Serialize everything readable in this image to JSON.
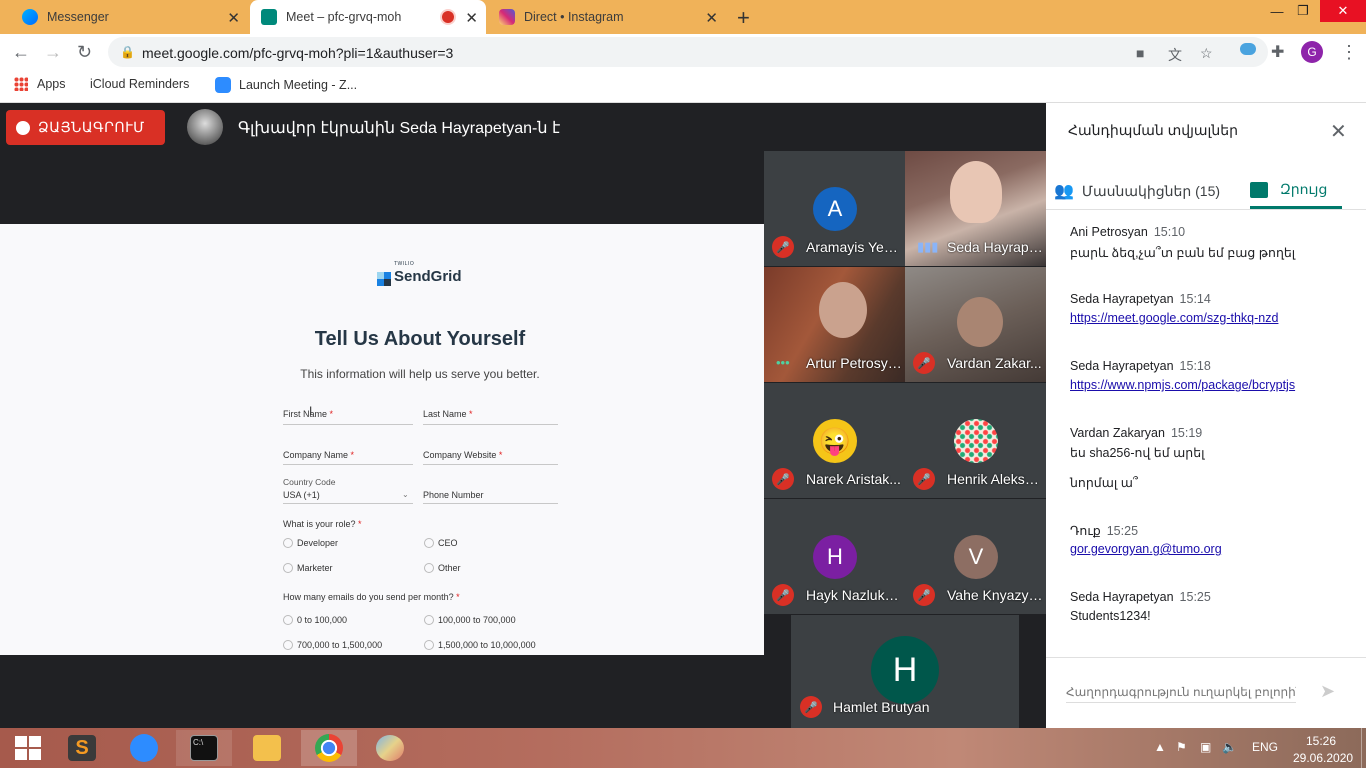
{
  "tabs": [
    {
      "label": "Messenger",
      "icon": "messenger-icon"
    },
    {
      "label": "Meet – pfc-grvq-moh",
      "icon": "meet-icon"
    },
    {
      "label": "Direct • Instagram",
      "icon": "instagram-icon"
    }
  ],
  "address": {
    "url": "meet.google.com/pfc-grvq-moh?pli=1&authuser=3"
  },
  "profile_initial": "G",
  "bookmarks": [
    {
      "label": "Apps"
    },
    {
      "label": "iCloud Reminders"
    },
    {
      "label": "Launch Meeting - Z..."
    }
  ],
  "meet": {
    "record_label": "ՁԱՅՆԱԳՐՈՒՄ",
    "presenter_text": "Գլխավոր էկրանին Seda Hayrapetyan-ն է"
  },
  "form": {
    "brand_small": "TWILIO",
    "brand": "SendGrid",
    "title": "Tell Us About Yourself",
    "subtitle": "This information will help us serve you better.",
    "first_name": "First Name",
    "last_name": "Last Name",
    "company_name": "Company Name",
    "company_website": "Company Website",
    "country_code_label": "Country Code",
    "country_code_value": "USA (+1)",
    "phone_number": "Phone Number",
    "role_question": "What is your role?",
    "roles": [
      "Developer",
      "CEO",
      "Marketer",
      "Other"
    ],
    "emails_question": "How many emails do you send per month?",
    "email_ranges": [
      "0 to 100,000",
      "100,000 to 700,000",
      "700,000 to 1,500,000",
      "1,500,000 to 10,000,000"
    ],
    "required_mark": "*"
  },
  "participants": [
    {
      "name": "Aramayis Yeg...",
      "initial": "A",
      "color": "#1565c0"
    },
    {
      "name": "Seda Hayrape...",
      "initial": "",
      "color": ""
    },
    {
      "name": "Artur Petrosyan",
      "initial": "",
      "color": ""
    },
    {
      "name": "Vardan Zakar...",
      "initial": "",
      "color": ""
    },
    {
      "name": "Narek Aristak...",
      "initial": "😜",
      "color": "#3c4043"
    },
    {
      "name": "Henrik Aleksa...",
      "initial": "",
      "color": "#e8e0d0"
    },
    {
      "name": "Hayk Nazlukh...",
      "initial": "H",
      "color": "#7b1fa2"
    },
    {
      "name": "Vahe Knyazyan",
      "initial": "V",
      "color": "#8d6e63"
    },
    {
      "name": "Hamlet Brutyan",
      "initial": "H",
      "color": "#00574b"
    }
  ],
  "panel": {
    "title": "Հանդիպման տվյալներ",
    "participants_tab": "Մասնակիցներ (15)",
    "chat_tab": "Զրույց",
    "messages": [
      {
        "sender": "Ani Petrosyan",
        "time": "15:10",
        "text": "բարև ձեզ,չա՞տ բան եմ բաց թողել"
      },
      {
        "sender": "Seda Hayrapetyan",
        "time": "15:14",
        "link": "https://meet.google.com/szg-thkq-nzd"
      },
      {
        "sender": "Seda Hayrapetyan",
        "time": "15:18",
        "link": "https://www.npmjs.com/package/bcryptjs"
      },
      {
        "sender": "Vardan Zakaryan",
        "time": "15:19",
        "text": "ես sha256-ով եմ արել",
        "text2": "նորմալ ա՞"
      },
      {
        "sender": "Դուք",
        "time": "15:25",
        "link": "gor.gevorgyan.g@tumo.org"
      },
      {
        "sender": "Seda Hayrapetyan",
        "time": "15:25",
        "text": "Students1234!"
      }
    ],
    "input_placeholder": "Հաղորդագրություն ուղարկել բոլորին"
  },
  "tray": {
    "lang": "ENG",
    "time": "15:26",
    "date": "29.06.2020"
  },
  "colors": {
    "tabstrip": "#f0b259",
    "record": "#d93025",
    "meet_green": "#00796b",
    "link": "#1a0dab"
  }
}
